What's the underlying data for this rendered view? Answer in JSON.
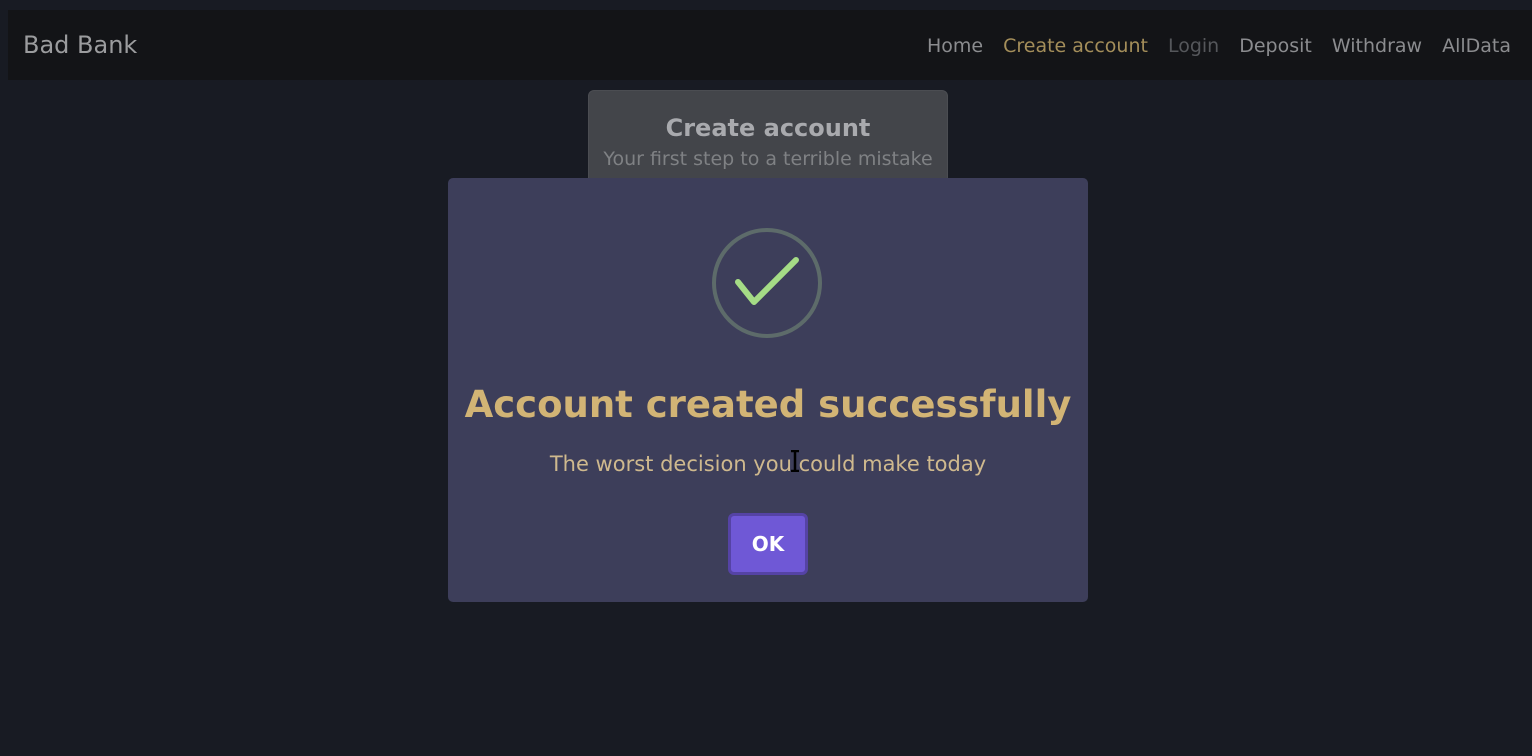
{
  "navbar": {
    "brand": "Bad Bank",
    "links": [
      {
        "label": "Home",
        "state": "default"
      },
      {
        "label": "Create account",
        "state": "active"
      },
      {
        "label": "Login",
        "state": "disabled"
      },
      {
        "label": "Deposit",
        "state": "default"
      },
      {
        "label": "Withdraw",
        "state": "default"
      },
      {
        "label": "AllData",
        "state": "default"
      }
    ]
  },
  "card": {
    "title": "Create account",
    "subtitle": "Your first step to a terrible mistake"
  },
  "modal": {
    "icon": "checkmark-success-icon",
    "title": "Account created successfully",
    "text": "The worst decision you could make today",
    "ok_label": "OK"
  },
  "colors": {
    "background": "#181b23",
    "navbar": "#131417",
    "modal_bg": "#3d3e5a",
    "accent_gold": "#d2b475",
    "button": "#6f58d6",
    "check": "#a5dc86"
  }
}
